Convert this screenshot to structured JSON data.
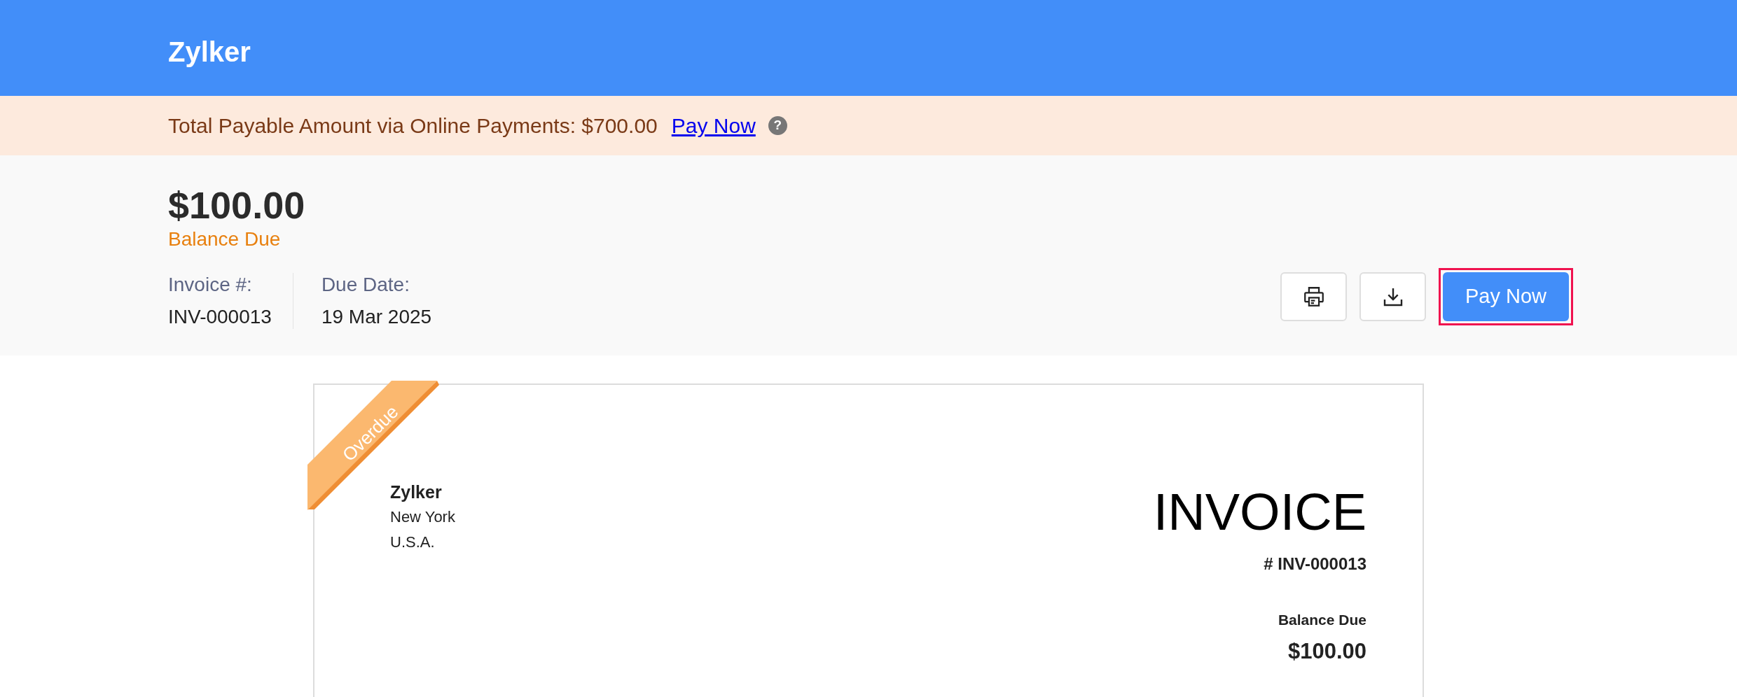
{
  "header": {
    "brand": "Zylker"
  },
  "banner": {
    "text": "Total Payable Amount via Online Payments: $700.00",
    "link": "Pay Now",
    "help": "?"
  },
  "summary": {
    "amount": "$100.00",
    "amount_label": "Balance Due",
    "fields": [
      {
        "label": "Invoice #:",
        "value": "INV-000013"
      },
      {
        "label": "Due Date:",
        "value": "19 Mar 2025"
      }
    ],
    "pay_button": {
      "label": "Pay Now",
      "focused": true
    }
  },
  "invoice": {
    "status": "Overdue",
    "from": {
      "name": "Zylker",
      "lines": [
        "New York",
        "U.S.A."
      ]
    },
    "title": "INVOICE",
    "number": "# INV-000013",
    "balance_label": "Balance Due",
    "balance": "$100.00"
  }
}
